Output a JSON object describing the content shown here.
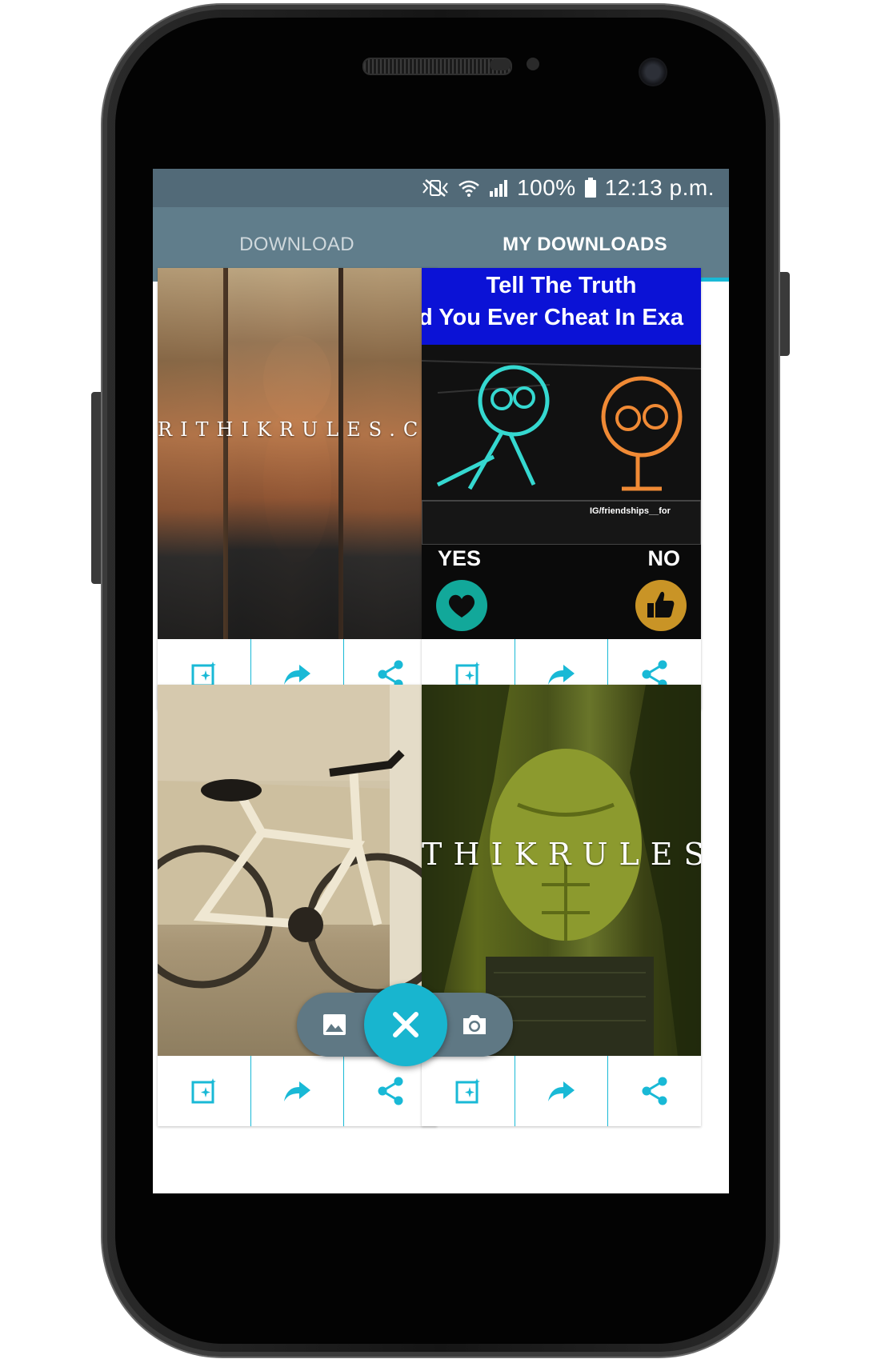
{
  "status_bar": {
    "battery_text": "100%",
    "time": "12:13 p.m.",
    "icons": [
      "mute-vibrate-icon",
      "wifi-icon",
      "signal-icon",
      "battery-icon"
    ]
  },
  "tabs": [
    {
      "label": "DOWNLOAD",
      "selected": false
    },
    {
      "label": "MY DOWNLOADS",
      "selected": true
    }
  ],
  "colors": {
    "status_bar": "#526a78",
    "tab_bar": "#607d8b",
    "accent": "#19b9d6",
    "fab": "#18b5cf"
  },
  "cards": [
    {
      "watermark": "RITHIKRULES.CO",
      "actions": [
        "edit-icon",
        "repost-icon",
        "share-icon"
      ]
    },
    {
      "quiz_title": "Tell The Truth",
      "quiz_question": "id You Ever Cheat In Exa",
      "quiz_handle": "IG/friendships__for",
      "yes_label": "YES",
      "no_label": "NO",
      "actions": [
        "edit-icon",
        "repost-icon",
        "share-icon"
      ]
    },
    {
      "actions": [
        "edit-icon",
        "repost-icon",
        "share-icon"
      ]
    },
    {
      "watermark": "THIKRULES",
      "actions": [
        "edit-icon",
        "repost-icon",
        "share-icon"
      ]
    }
  ],
  "fab": {
    "main_icon": "close-icon",
    "mini_actions": [
      "gallery-icon",
      "camera-icon"
    ]
  }
}
